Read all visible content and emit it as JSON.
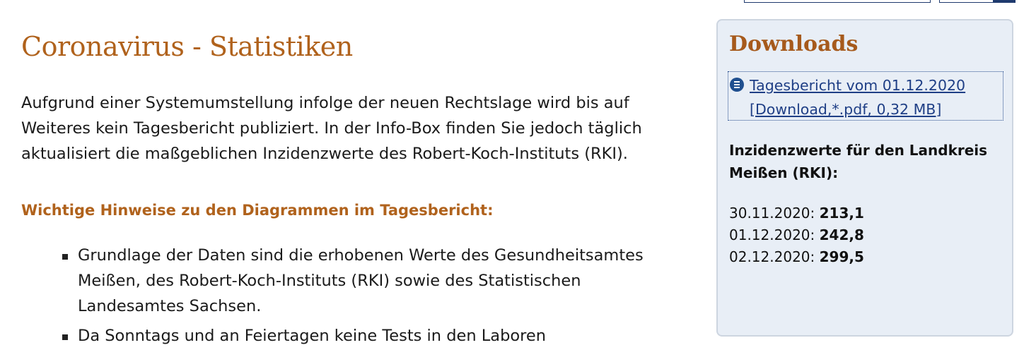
{
  "main": {
    "title": "Coronavirus - Statistiken",
    "intro": "Aufgrund einer Systemumstellung infolge der neuen Rechtslage wird bis auf Weiteres kein Tagesbericht publiziert. In der Info-Box finden Sie jedoch täglich aktualisiert die maßgeblichen Inzidenzwerte des Robert-Koch-Instituts (RKI).",
    "section_heading": "Wichtige Hinweise zu den Diagrammen im Tagesbericht:",
    "bullets": [
      "Grundlage der Daten sind die erhobenen Werte des Gesundheitsamtes Meißen, des Robert-Koch-Instituts (RKI) sowie des Statistischen Landesamtes Sachsen.",
      "Da Sonntags und an Feiertagen keine Tests in den Laboren"
    ]
  },
  "sidebar": {
    "title": "Downloads",
    "download_link": {
      "line1": "Tagesbericht vom 01.12.2020",
      "line2": "[Download,*.pdf, 0,32 MB]"
    },
    "incidence_title": "Inzidenzwerte für den Landkreis Meißen (RKI):",
    "incidence": [
      {
        "date": "30.11.2020:",
        "value": "213,1"
      },
      {
        "date": "01.12.2020:",
        "value": "242,8"
      },
      {
        "date": "02.12.2020:",
        "value": "299,5"
      }
    ]
  },
  "colors": {
    "accent": "#b0621c",
    "link": "#1f3f86",
    "sidebar_bg": "#e8eef6"
  },
  "icons": {
    "download": "document-list-icon",
    "bullet": "square-bullet"
  }
}
